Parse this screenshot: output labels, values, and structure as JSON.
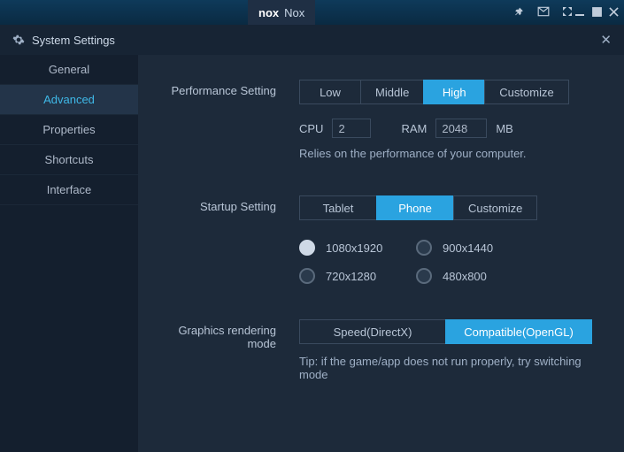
{
  "app": {
    "name": "Nox",
    "logo": "nox"
  },
  "settingsWindow": {
    "title": "System Settings"
  },
  "sidebar": {
    "items": [
      {
        "id": "general",
        "label": "General"
      },
      {
        "id": "advanced",
        "label": "Advanced"
      },
      {
        "id": "properties",
        "label": "Properties"
      },
      {
        "id": "shortcuts",
        "label": "Shortcuts"
      },
      {
        "id": "interface",
        "label": "Interface"
      }
    ],
    "activeId": "advanced"
  },
  "performance": {
    "label": "Performance Setting",
    "buttons": [
      {
        "id": "low",
        "label": "Low"
      },
      {
        "id": "middle",
        "label": "Middle"
      },
      {
        "id": "high",
        "label": "High"
      },
      {
        "id": "customize",
        "label": "Customize"
      }
    ],
    "activeId": "high",
    "cpuLabel": "CPU",
    "cpuValue": "2",
    "ramLabel": "RAM",
    "ramValue": "2048",
    "ramUnit": "MB",
    "hint": "Relies on the performance of your computer."
  },
  "startup": {
    "label": "Startup Setting",
    "buttons": [
      {
        "id": "tablet",
        "label": "Tablet"
      },
      {
        "id": "phone",
        "label": "Phone"
      },
      {
        "id": "customize",
        "label": "Customize"
      }
    ],
    "activeId": "phone",
    "resolutions": [
      {
        "id": "1080x1920",
        "label": "1080x1920"
      },
      {
        "id": "900x1440",
        "label": "900x1440"
      },
      {
        "id": "720x1280",
        "label": "720x1280"
      },
      {
        "id": "480x800",
        "label": "480x800"
      }
    ],
    "selectedResolution": "1080x1920"
  },
  "graphics": {
    "label": "Graphics rendering mode",
    "buttons": [
      {
        "id": "speed",
        "label": "Speed(DirectX)"
      },
      {
        "id": "compat",
        "label": "Compatible(OpenGL)"
      }
    ],
    "activeId": "compat",
    "hint": "Tip: if the game/app does not run properly, try switching mode"
  }
}
